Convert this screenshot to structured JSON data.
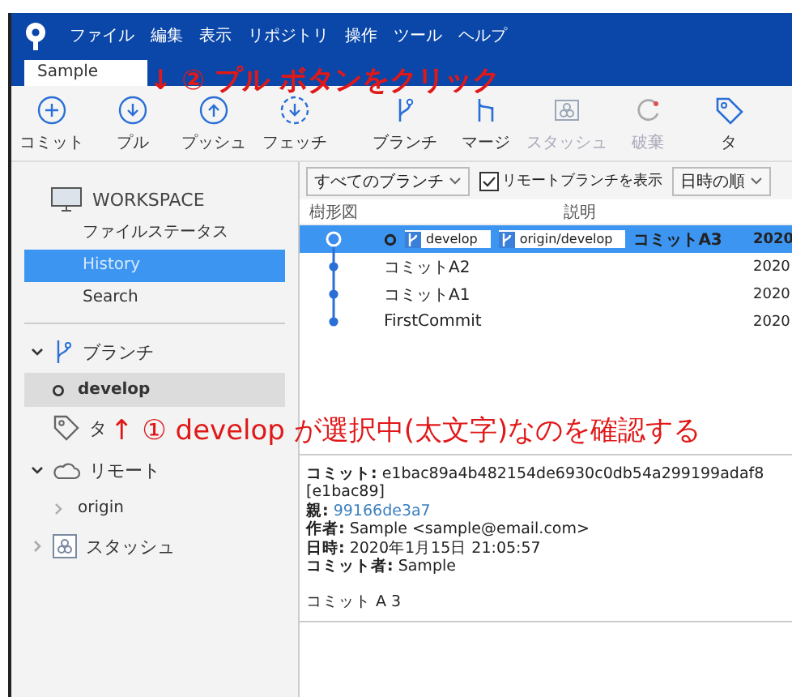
{
  "menu": [
    "ファイル",
    "編集",
    "表示",
    "リポジトリ",
    "操作",
    "ツール",
    "ヘルプ"
  ],
  "tabs": [
    {
      "label": "Sample",
      "selected": true
    }
  ],
  "toolbar": [
    {
      "label": "コミット",
      "kind": "plus",
      "disabled": false
    },
    {
      "label": "プル",
      "kind": "down",
      "disabled": false
    },
    {
      "label": "プッシュ",
      "kind": "up",
      "disabled": false
    },
    {
      "label": "フェッチ",
      "kind": "fetch",
      "disabled": false
    },
    {
      "label": "ブランチ",
      "kind": "branch",
      "disabled": false
    },
    {
      "label": "マージ",
      "kind": "merge",
      "disabled": false
    },
    {
      "label": "スタッシュ",
      "kind": "stash",
      "disabled": true
    },
    {
      "label": "破棄",
      "kind": "discard",
      "disabled": true
    },
    {
      "label": "タ",
      "kind": "tag",
      "disabled": false
    }
  ],
  "sidebar": {
    "workspace": {
      "title": "WORKSPACE",
      "items": [
        {
          "label": "ファイルステータス",
          "selected": false
        },
        {
          "label": "History",
          "selected": true
        },
        {
          "label": "Search",
          "selected": false
        }
      ]
    },
    "sections": [
      {
        "label": "ブランチ",
        "kind": "branch",
        "expanded": true,
        "children": [
          {
            "label": "develop",
            "selected": true,
            "current": true
          }
        ]
      },
      {
        "label": "タ",
        "kind": "tag"
      },
      {
        "label": "リモート",
        "kind": "cloud",
        "expanded": true,
        "children": [
          {
            "label": "origin",
            "expanded": false
          }
        ]
      },
      {
        "label": "スタッシュ",
        "kind": "stash",
        "expanded": false
      }
    ]
  },
  "history": {
    "filters": {
      "branches": "すべてのブランチ",
      "show_remote": {
        "label": "リモートブランチを表示",
        "checked": true
      },
      "sort": "日時の順"
    },
    "columns": [
      "樹形図",
      "説明"
    ],
    "rows": [
      {
        "selected": true,
        "head": true,
        "refs": [
          "develop",
          "origin/develop"
        ],
        "description": "コミットA3",
        "date": "2020"
      },
      {
        "selected": false,
        "head": false,
        "refs": [],
        "description": "コミットA2",
        "date": "2020"
      },
      {
        "selected": false,
        "head": false,
        "refs": [],
        "description": "コミットA1",
        "date": "2020"
      },
      {
        "selected": false,
        "head": false,
        "refs": [],
        "description": "FirstCommit",
        "date": "2020"
      }
    ]
  },
  "details": [
    {
      "kind": "field",
      "label": "コミット:",
      "value": "e1bac89a4b482154de6930c0db54a299199adaf8"
    },
    {
      "kind": "plain",
      "value": "[e1bac89]"
    },
    {
      "kind": "link",
      "label": "親:",
      "value": "99166de3a7"
    },
    {
      "kind": "field",
      "label": "作者:",
      "value": "Sample <sample@email.com>"
    },
    {
      "kind": "field",
      "label": "日時:",
      "value": "2020年1月15日 21:05:57"
    },
    {
      "kind": "field",
      "label": "コミット者:",
      "value": "Sample"
    },
    {
      "kind": "message",
      "value": "コミット A 3"
    }
  ],
  "annotations": [
    {
      "text": "↓ ② プル ボタンをクリック"
    },
    {
      "text": "↑ ① develop が選択中(太文字)なのを確認する"
    }
  ]
}
